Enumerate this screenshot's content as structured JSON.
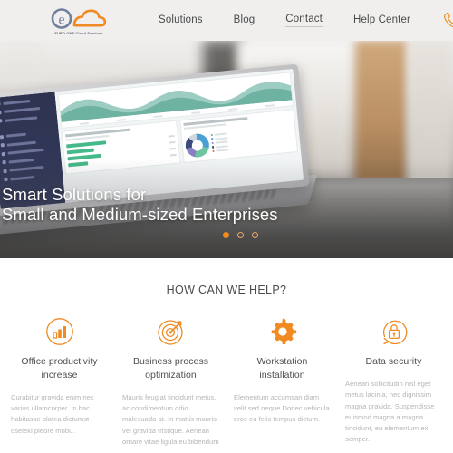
{
  "brand": {
    "name": "EURO ONE Cloud Services",
    "logo_letter": "e",
    "accent_color": "#ef8b22",
    "logo_blue": "#6f7f9e"
  },
  "nav": {
    "items": [
      {
        "label": "Solutions",
        "active": false
      },
      {
        "label": "Blog",
        "active": false
      },
      {
        "label": "Contact",
        "active": true
      },
      {
        "label": "Help Center",
        "active": false
      }
    ],
    "phone_icon": "phone-icon"
  },
  "hero": {
    "headline_line1": "Smart Solutions for",
    "headline_line2": "Small and Medium-sized Enterprises",
    "carousel": {
      "total": 3,
      "active_index": 0
    }
  },
  "help": {
    "title": "HOW CAN WE HELP?",
    "features": [
      {
        "icon": "bar-chart-icon",
        "title": "Office productivity increase",
        "body": "Curabitur gravida enim nec varius ullamcorper. In hac habitasse platea dictumst dseleki pieore mobu."
      },
      {
        "icon": "target-icon",
        "title": "Business process optimization",
        "body": "Mauris feugiat tincidunt metus, ac condimentum odio malesuada at. In mattis mauris vel gravida tristique. Aenean ornare vitae ligula eu bibendum"
      },
      {
        "icon": "gear-icon",
        "title": "Workstation installation",
        "body": "Elementum accumsan diam velit sed neque.Donec vehicula eros eu felis tempus dictum."
      },
      {
        "icon": "lock-refresh-icon",
        "title": "Data security",
        "body": "Aenean sollicitudin nisl eget metus lacinia, nec dignissim magna gravida. Suspendisse euismod magna a magna tincidunt, eu elementum ex semper."
      }
    ]
  }
}
